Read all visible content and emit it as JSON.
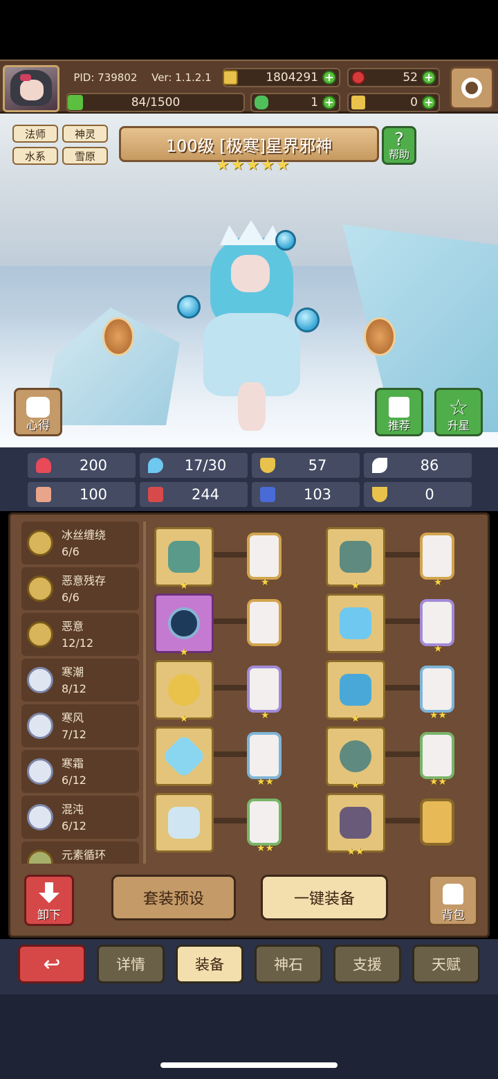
{
  "header": {
    "pid": "PID: 739802",
    "version": "Ver: 1.1.2.1",
    "gold": "1804291",
    "gems": "52",
    "stamina": "84/1500",
    "clover": "1",
    "key": "0"
  },
  "hero": {
    "tags": [
      "法师",
      "神灵",
      "水系",
      "雪原"
    ],
    "title": "100级 [极寒]星界邪神",
    "stars": "★★★★★",
    "help_label": "帮助",
    "insight_label": "心得",
    "recommend_label": "推荐",
    "upstar_label": "升星"
  },
  "stats": [
    {
      "icon": "heart-icon",
      "value": "200",
      "color": "#e84a5a"
    },
    {
      "icon": "drop-icon",
      "value": "17/30",
      "color": "#6ec8f0"
    },
    {
      "icon": "shield-icon",
      "value": "57",
      "color": "#e8c24a"
    },
    {
      "icon": "wing-icon",
      "value": "86",
      "color": "#ffffff"
    },
    {
      "icon": "fist-icon",
      "value": "100",
      "color": "#e8a58a"
    },
    {
      "icon": "book-icon",
      "value": "244",
      "color": "#d84a4a"
    },
    {
      "icon": "scroll-icon",
      "value": "103",
      "color": "#4a6ad8"
    },
    {
      "icon": "magnet-icon",
      "value": "0",
      "color": "#e8c24a"
    }
  ],
  "sets": [
    {
      "name": "冰丝缠绕",
      "count": "6/6"
    },
    {
      "name": "恶意残存",
      "count": "6/6"
    },
    {
      "name": "恶意",
      "count": "12/12"
    },
    {
      "name": "寒潮",
      "count": "8/12"
    },
    {
      "name": "寒风",
      "count": "7/12"
    },
    {
      "name": "寒霜",
      "count": "6/12"
    },
    {
      "name": "混沌",
      "count": "6/12"
    },
    {
      "name": "元素循环",
      "count": ""
    }
  ],
  "buttons": {
    "unequip": "卸下",
    "preset": "套装预设",
    "one_click": "一键装备",
    "bag": "背包"
  },
  "tabs": [
    "详情",
    "装备",
    "神石",
    "支援",
    "天赋"
  ],
  "colors": {
    "accent": "#c49a68",
    "panel": "#6e4c35",
    "stat_bg": "#444b63"
  }
}
